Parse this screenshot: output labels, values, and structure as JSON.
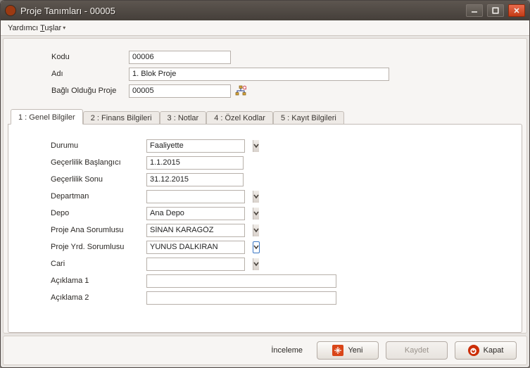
{
  "window": {
    "title": "Proje Tanımları - 00005"
  },
  "menu": {
    "helpers": "Yardımcı Tuşlar",
    "helpers_underline": "T"
  },
  "top": {
    "code_label": "Kodu",
    "name_label": "Adı",
    "parent_label": "Bağlı Olduğu Proje",
    "code": "00006",
    "name": "1. Blok Proje",
    "parent": "00005"
  },
  "tabs": [
    {
      "label": "1 : Genel Bilgiler"
    },
    {
      "label": "2 : Finans Bilgileri"
    },
    {
      "label": "3 : Notlar"
    },
    {
      "label": "4 : Özel Kodlar"
    },
    {
      "label": "5 : Kayıt Bilgileri"
    }
  ],
  "general": {
    "status_label": "Durumu",
    "status": "Faaliyette",
    "valid_from_label": "Geçerlilik Başlangıcı",
    "valid_from": "1.1.2015",
    "valid_to_label": "Geçerlilik Sonu",
    "valid_to": "31.12.2015",
    "dept_label": "Departman",
    "dept": "",
    "depot_label": "Depo",
    "depot": "Ana Depo",
    "main_resp_label": "Proje Ana Sorumlusu",
    "main_resp": "SİNAN KARAGÖZ",
    "asst_resp_label": "Proje Yrd. Sorumlusu",
    "asst_resp": "YUNUS DALKIRAN",
    "cari_label": "Cari",
    "cari": "",
    "note1_label": "Açıklama 1",
    "note1": "",
    "note2_label": "Açıklama 2",
    "note2": ""
  },
  "footer": {
    "review": "İnceleme",
    "new": "Yeni",
    "save": "Kaydet",
    "close": "Kapat"
  }
}
